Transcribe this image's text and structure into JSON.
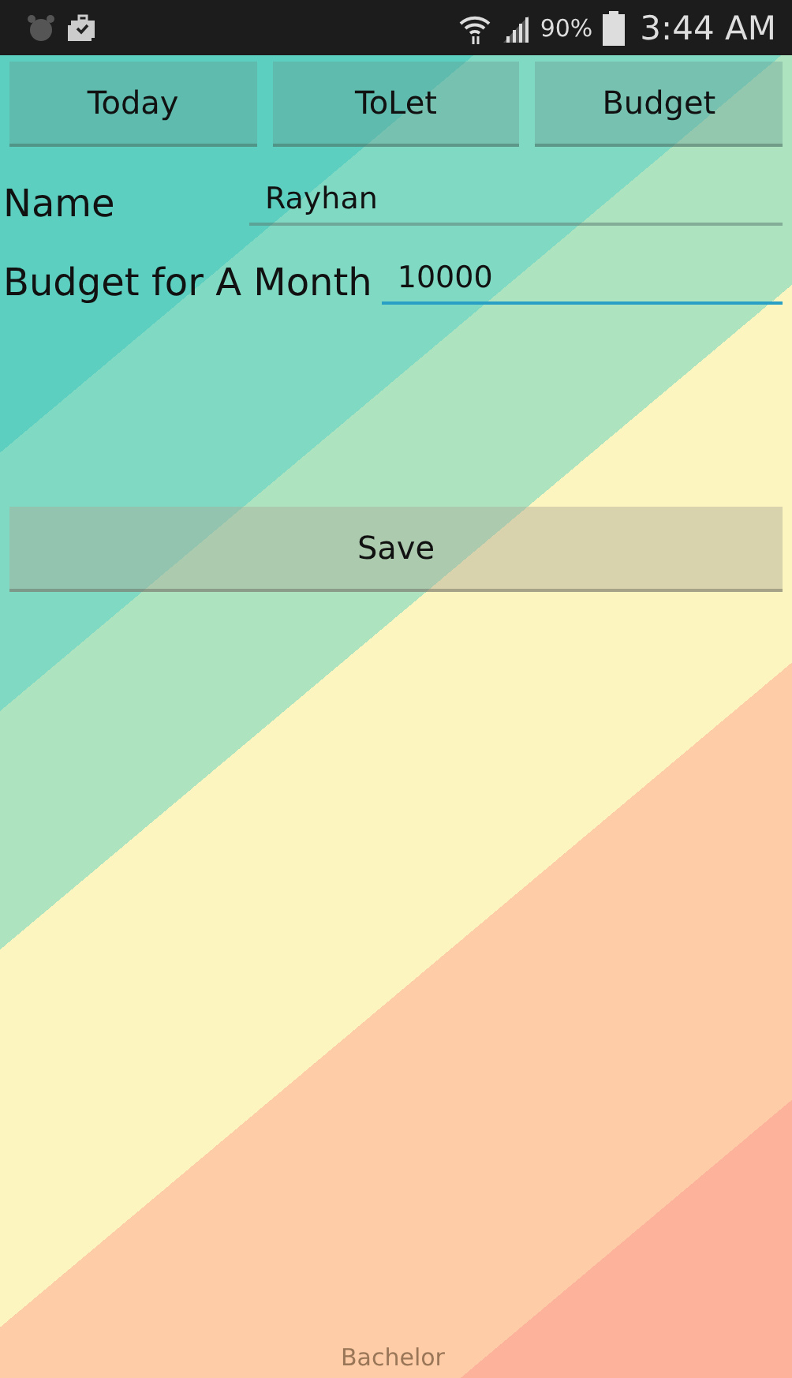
{
  "status_bar": {
    "battery": "90%",
    "time": "3:44 AM"
  },
  "tabs": [
    {
      "label": "Today"
    },
    {
      "label": "ToLet"
    },
    {
      "label": "Budget"
    }
  ],
  "fields": [
    {
      "label": "Name",
      "value": "Rayhan",
      "focused": false
    },
    {
      "label": "Budget for A Month",
      "value": "10000",
      "focused": true
    }
  ],
  "save_button": "Save",
  "footer": "Bachelor"
}
